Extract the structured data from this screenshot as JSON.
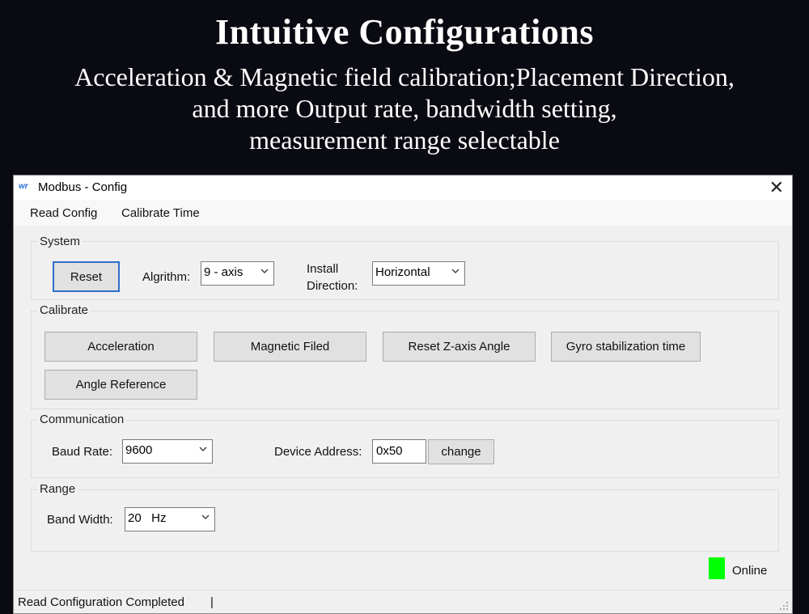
{
  "banner": {
    "title": "Intuitive Configurations",
    "line1": "Acceleration & Magnetic field calibration;Placement Direction,",
    "line2": "and more Output rate, bandwidth setting,",
    "line3": "measurement range selectable"
  },
  "window": {
    "icon_text": "wr",
    "title": "Modbus - Config",
    "close_glyph": "✕"
  },
  "menu": [
    "Read Config",
    "Calibrate Time"
  ],
  "system": {
    "label": "System",
    "reset_label": "Reset",
    "algorithm_label": "Algrithm:",
    "algorithm_value": "9 - axis",
    "install_label_1": "Install",
    "install_label_2": "Direction:",
    "install_value": "Horizontal"
  },
  "calibrate": {
    "label": "Calibrate",
    "buttons": [
      "Acceleration",
      "Magnetic Filed",
      "Reset Z-axis Angle",
      "Gyro stabilization time",
      "Angle Reference"
    ]
  },
  "communication": {
    "label": "Communication",
    "baud_label": "Baud Rate:",
    "baud_value": "9600",
    "address_label": "Device Address:",
    "address_value": "0x50",
    "change_label": "change"
  },
  "range": {
    "label": "Range",
    "bandwidth_label": "Band Width:",
    "bandwidth_value": "20   Hz"
  },
  "connection": {
    "status": "Online",
    "color": "#00ff00"
  },
  "statusbar": {
    "text": "Read Configuration Completed",
    "separator": "|"
  }
}
